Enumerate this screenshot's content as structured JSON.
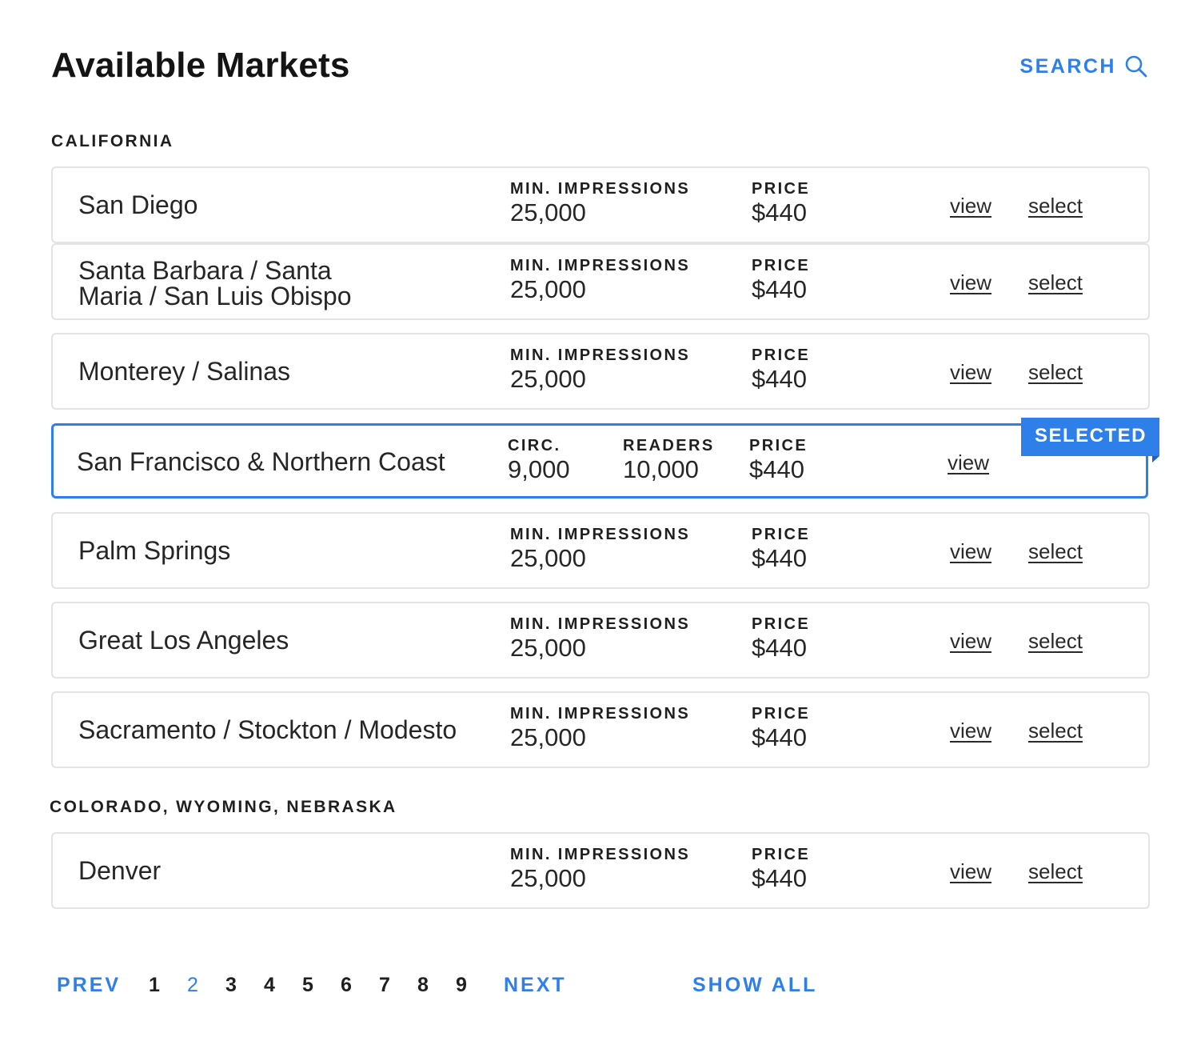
{
  "header": {
    "title": "Available Markets",
    "search_label": "SEARCH"
  },
  "labels": {
    "view": "view",
    "select": "select",
    "selected_badge": "SELECTED"
  },
  "sections": [
    {
      "name": "CALIFORNIA",
      "markets": [
        {
          "name": "San Diego",
          "stat1_label": "MIN. IMPRESSIONS",
          "stat1_value": "25,000",
          "price_label": "PRICE",
          "price": "$440"
        },
        {
          "name": "Santa Barbara / Santa Maria / San Luis Obispo",
          "stat1_label": "MIN. IMPRESSIONS",
          "stat1_value": "25,000",
          "price_label": "PRICE",
          "price": "$440"
        },
        {
          "name": "Monterey / Salinas",
          "stat1_label": "MIN. IMPRESSIONS",
          "stat1_value": "25,000",
          "price_label": "PRICE",
          "price": "$440"
        },
        {
          "name": "San Francisco & Northern Coast",
          "selected": true,
          "circ_label": "CIRC.",
          "circ_value": "9,000",
          "readers_label": "READERS",
          "readers_value": "10,000",
          "price_label": "PRICE",
          "price": "$440"
        },
        {
          "name": "Palm Springs",
          "stat1_label": "MIN. IMPRESSIONS",
          "stat1_value": "25,000",
          "price_label": "PRICE",
          "price": "$440"
        },
        {
          "name": "Great Los Angeles",
          "stat1_label": "MIN. IMPRESSIONS",
          "stat1_value": "25,000",
          "price_label": "PRICE",
          "price": "$440"
        },
        {
          "name": "Sacramento / Stockton / Modesto",
          "stat1_label": "MIN. IMPRESSIONS",
          "stat1_value": "25,000",
          "price_label": "PRICE",
          "price": "$440"
        }
      ]
    },
    {
      "name": "COLORADO, WYOMING, NEBRASKA",
      "markets": [
        {
          "name": "Denver",
          "stat1_label": "MIN. IMPRESSIONS",
          "stat1_value": "25,000",
          "price_label": "PRICE",
          "price": "$440"
        }
      ]
    }
  ],
  "pagination": {
    "prev": "PREV",
    "pages": [
      "1",
      "2",
      "3",
      "4",
      "5",
      "6",
      "7",
      "8",
      "9"
    ],
    "current_page": "2",
    "next": "NEXT",
    "show_all": "SHOW ALL"
  },
  "colors": {
    "accent": "#2f7fea",
    "card_border": "#e4e4e4",
    "text": "#1f1f1f"
  }
}
